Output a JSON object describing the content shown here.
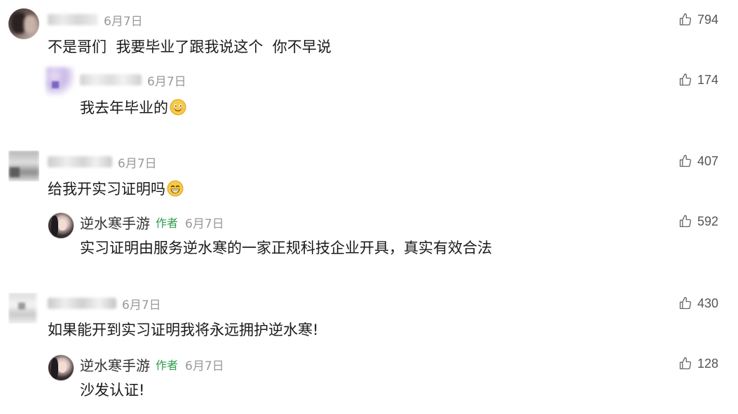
{
  "comments": [
    {
      "date": "6月7日",
      "text": "不是哥们  我要毕业了跟我说这个  你不早说",
      "likes": "794",
      "emoji": "",
      "reply": {
        "date": "6月7日",
        "text": "我去年毕业的",
        "likes": "174",
        "emoji": "smiling-face-emoji"
      }
    },
    {
      "date": "6月7日",
      "text": "给我开实习证明吗",
      "likes": "407",
      "emoji": "grinning-face-emoji",
      "reply": {
        "author": "逆水寒手游",
        "author_tag": "作者",
        "date": "6月7日",
        "text": "实习证明由服务逆水寒的一家正规科技企业开具，真实有效合法",
        "likes": "592"
      }
    },
    {
      "date": "6月7日",
      "text": "如果能开到实习证明我将永远拥护逆水寒!",
      "likes": "430",
      "reply": {
        "author": "逆水寒手游",
        "author_tag": "作者",
        "date": "6月7日",
        "text": "沙发认证!",
        "likes": "128"
      }
    }
  ],
  "icons": {
    "like": "thumbs-up-icon"
  },
  "colors": {
    "author_tag": "#2e9c4c",
    "meta_gray": "#999999",
    "text": "#1a1a1a"
  }
}
